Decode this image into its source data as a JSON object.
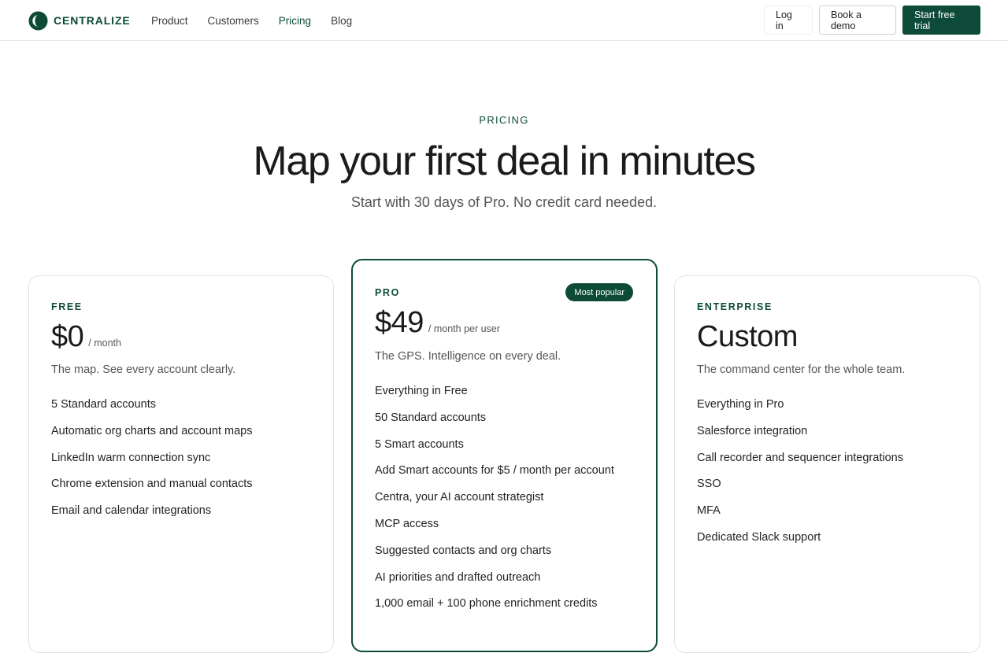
{
  "brand": {
    "name": "CENTRALIZE",
    "color": "#0d4a38"
  },
  "nav": {
    "items": [
      {
        "label": "Product"
      },
      {
        "label": "Customers"
      },
      {
        "label": "Pricing",
        "active": true
      },
      {
        "label": "Blog"
      }
    ]
  },
  "actions": {
    "login": "Log in",
    "demo": "Book a demo",
    "trial": "Start free trial"
  },
  "hero": {
    "eyebrow": "PRICING",
    "title": "Map your first deal in minutes",
    "subtitle": "Start with 30 days of Pro. No credit card needed."
  },
  "plans": [
    {
      "tier": "FREE",
      "price": "$0",
      "per": "/ month",
      "desc": "The map. See every account clearly.",
      "features": [
        "5 Standard accounts",
        "Automatic org charts and account maps",
        "LinkedIn warm connection sync",
        "Chrome extension and manual contacts",
        "Email and calendar integrations"
      ]
    },
    {
      "tier": "PRO",
      "badge": "Most popular",
      "price": "$49",
      "per": "/ month per user",
      "desc": "The GPS. Intelligence on every deal.",
      "features": [
        "Everything in Free",
        "50 Standard accounts",
        "5 Smart accounts",
        "Add Smart accounts for $5 / month per account",
        "Centra, your AI account strategist",
        "MCP access",
        "Suggested contacts and org charts",
        "AI priorities and drafted outreach",
        "1,000 email + 100 phone enrichment credits"
      ]
    },
    {
      "tier": "ENTERPRISE",
      "price": "Custom",
      "per": "",
      "desc": "The command center for the whole team.",
      "features": [
        "Everything in Pro",
        "Salesforce integration",
        "Call recorder and sequencer integrations",
        "SSO",
        "MFA",
        "Dedicated Slack support"
      ]
    }
  ]
}
